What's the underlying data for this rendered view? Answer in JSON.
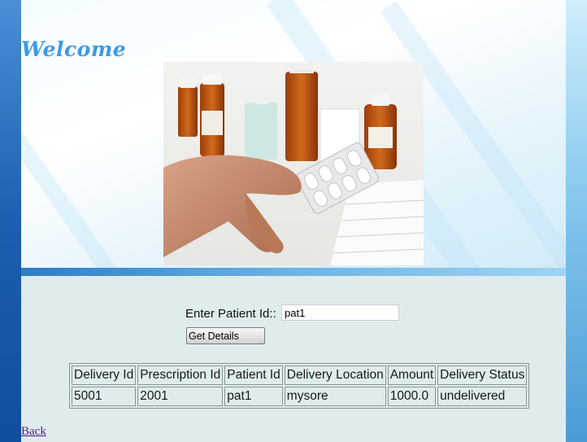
{
  "header": {
    "title": "Welcome"
  },
  "form": {
    "label": "Enter Patient Id::",
    "patient_id_value": "pat1",
    "submit_label": "Get Details"
  },
  "table": {
    "headers": [
      "Delivery Id",
      "Prescription Id",
      "Patient Id",
      "Delivery Location",
      "Amount",
      "Delivery Status"
    ],
    "rows": [
      [
        "5001",
        "2001",
        "pat1",
        "mysore",
        "1000.0",
        "undelivered"
      ]
    ]
  },
  "footer": {
    "back_label": "Back"
  },
  "colors": {
    "title": "#3b9be8",
    "link_visited": "#551a8b",
    "panel_bg": "#dfeced"
  }
}
